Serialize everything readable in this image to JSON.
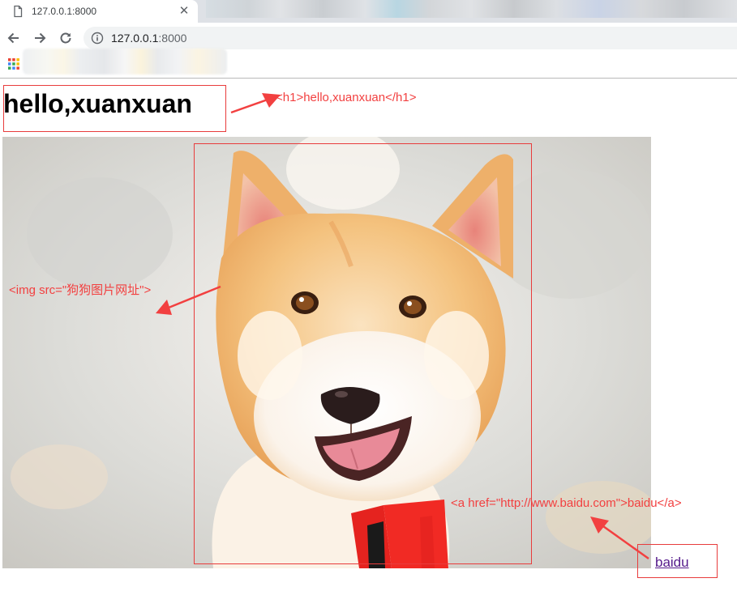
{
  "browser": {
    "tab_title": "127.0.0.1:8000",
    "tab_close": "✕",
    "url_host": "127.0.0.1",
    "url_port": ":8000"
  },
  "page": {
    "heading": "hello,xuanxuan",
    "link_text": "baidu"
  },
  "annotations": {
    "h1": "<h1>hello,xuanxuan</h1>",
    "img": "<img src=\"狗狗图片网址\">",
    "a": "<a href=\"http://www.baidu.com\">baidu</a>"
  },
  "colors": {
    "annotation": "#f24040",
    "visited_link": "#551a8b",
    "tabstrip": "#dee1e6",
    "omnibox": "#f1f3f4"
  }
}
